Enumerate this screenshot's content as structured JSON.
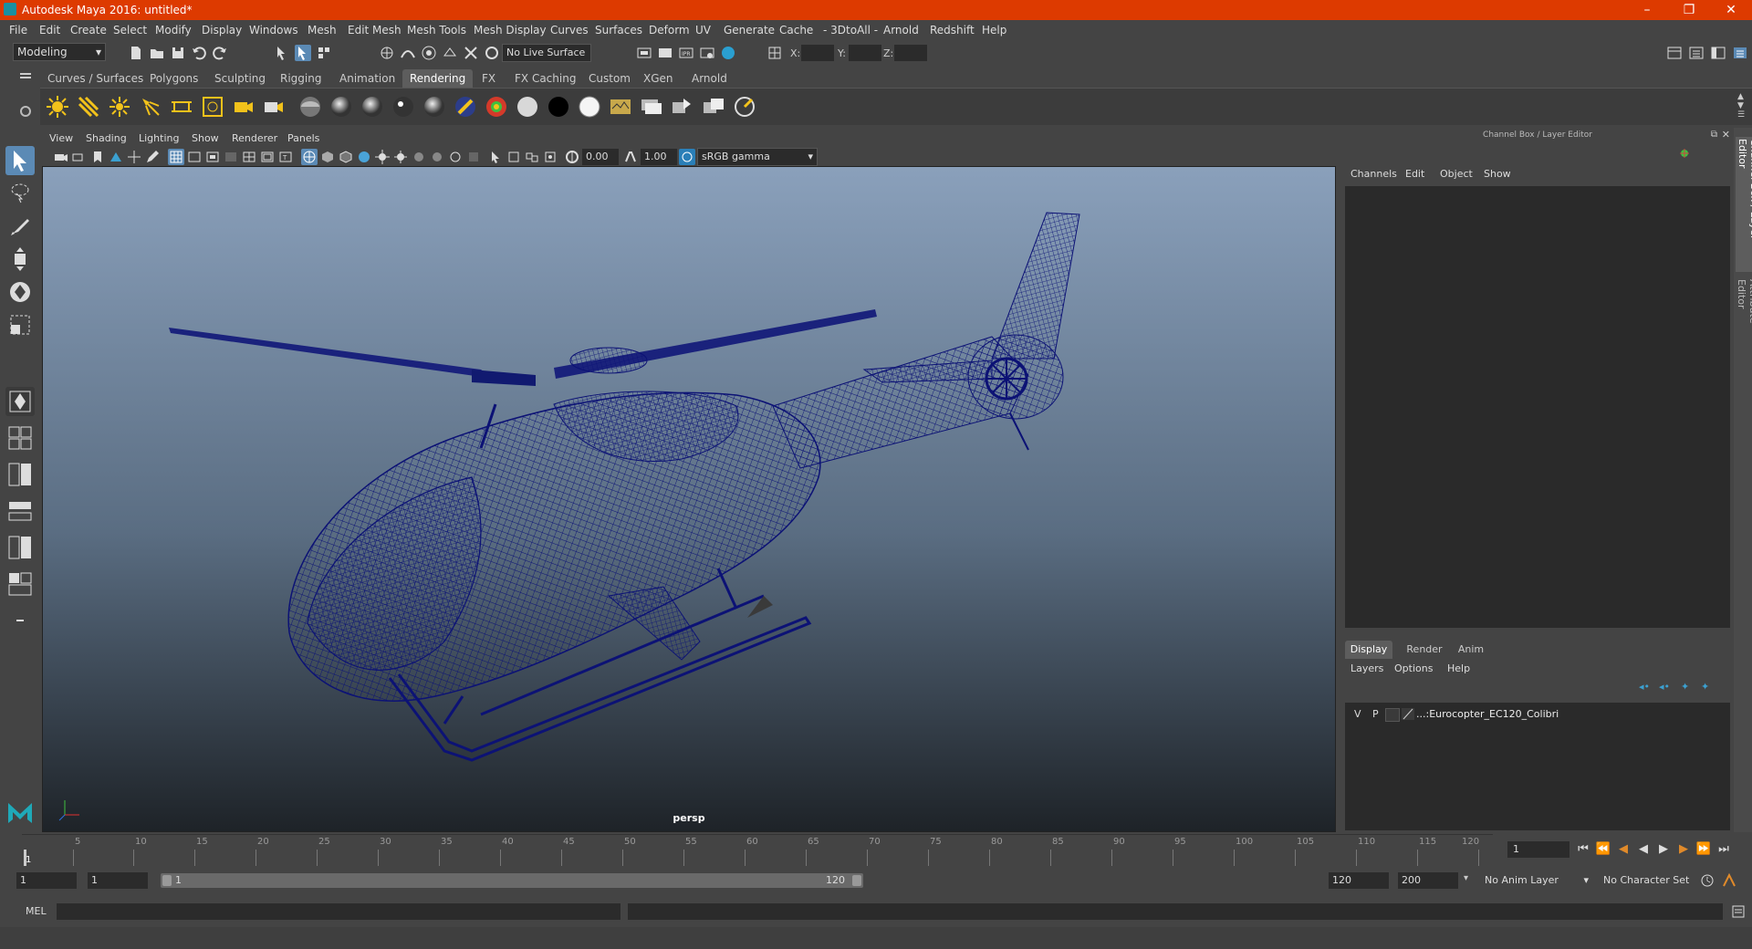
{
  "window": {
    "title": "Autodesk Maya 2016: untitled*"
  },
  "menubar": [
    "File",
    "Edit",
    "Create",
    "Select",
    "Modify",
    "Display",
    "Windows",
    "Mesh",
    "Edit Mesh",
    "Mesh Tools",
    "Mesh Display",
    "Curves",
    "Surfaces",
    "Deform",
    "UV",
    "Generate",
    "Cache",
    "- 3DtoAll -",
    "Arnold",
    "Redshift",
    "Help"
  ],
  "status": {
    "mode": "Modeling",
    "live_surface": "No Live Surface",
    "x_label": "X:",
    "y_label": "Y:",
    "z_label": "Z:"
  },
  "shelf_tabs": [
    "Curves / Surfaces",
    "Polygons",
    "Sculpting",
    "Rigging",
    "Animation",
    "Rendering",
    "FX",
    "FX Caching",
    "Custom",
    "XGen",
    "Arnold"
  ],
  "shelf_active": "Rendering",
  "viewport": {
    "menu": [
      "View",
      "Shading",
      "Lighting",
      "Show",
      "Renderer",
      "Panels"
    ],
    "exposure": "0.00",
    "gamma": "1.00",
    "colorspace": "sRGB gamma",
    "camera": "persp"
  },
  "channel_box": {
    "title": "Channel Box / Layer Editor",
    "menu": [
      "Channels",
      "Edit",
      "Object",
      "Show"
    ],
    "tabs": [
      "Display",
      "Render",
      "Anim"
    ],
    "active_tab": "Display",
    "layer_menu": [
      "Layers",
      "Options",
      "Help"
    ],
    "layer": {
      "v": "V",
      "p": "P",
      "name": "...:Eurocopter_EC120_Colibri"
    }
  },
  "side_tabs": [
    "Channel Box / Layer Editor",
    "Attribute Editor"
  ],
  "timeline": {
    "ticks": [
      "1",
      "5",
      "10",
      "15",
      "20",
      "25",
      "30",
      "35",
      "40",
      "45",
      "50",
      "55",
      "60",
      "65",
      "70",
      "75",
      "80",
      "85",
      "90",
      "95",
      "100",
      "105",
      "110",
      "115",
      "120"
    ],
    "current_frame": "1"
  },
  "range": {
    "start": "1",
    "playback_start": "1",
    "slider_start": "1",
    "slider_end": "120",
    "playback_end": "120",
    "end": "200",
    "anim_layer": "No Anim Layer",
    "character_set": "No Character Set"
  },
  "cmd": {
    "label": "MEL"
  }
}
